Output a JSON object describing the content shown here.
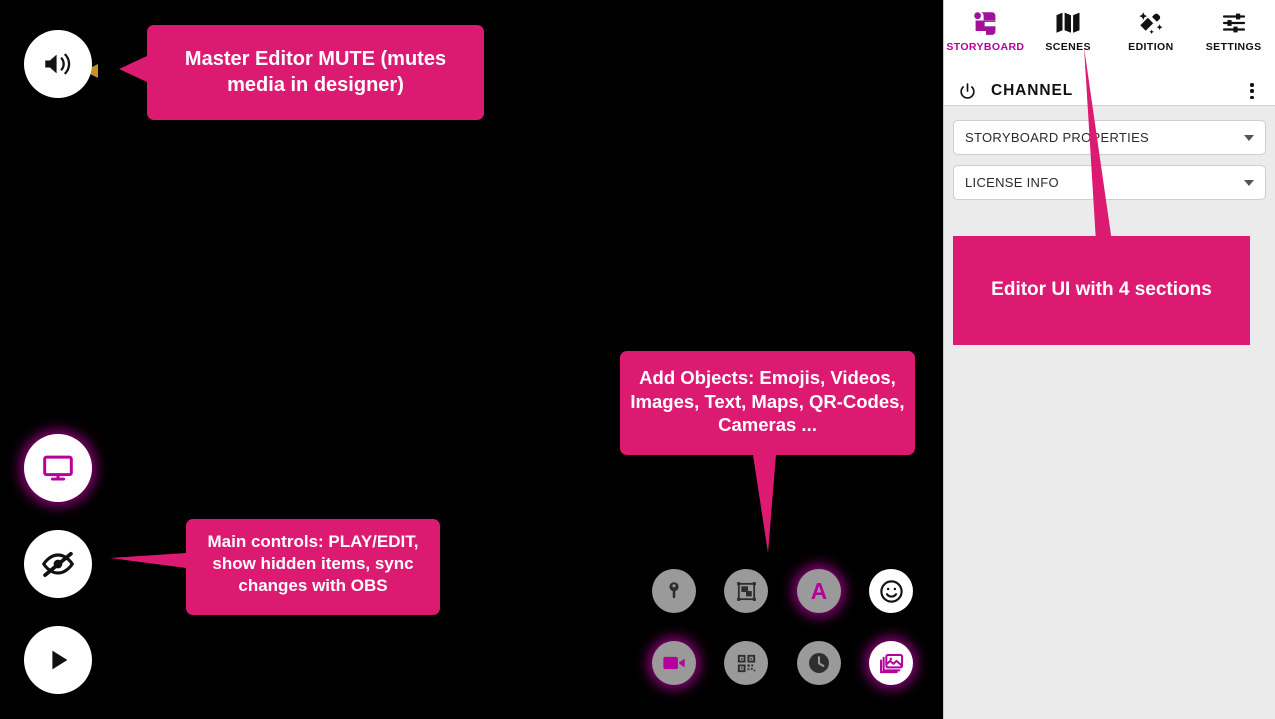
{
  "theme": {
    "callout_pink": "#dd1a71",
    "accent_magenta": "#b5009c",
    "canvas_bg": "#000000",
    "panel_bg": "#ebebeb"
  },
  "canvas": {
    "controls": [
      {
        "name": "master-mute",
        "icon": "speaker-icon",
        "label": "Master Editor MUTE"
      },
      {
        "name": "display-preview",
        "icon": "monitor-icon",
        "label": "Display"
      },
      {
        "name": "show-hidden",
        "icon": "eye-off-icon",
        "label": "Show hidden items"
      },
      {
        "name": "play",
        "icon": "play-icon",
        "label": "Play"
      }
    ],
    "objects": [
      {
        "name": "add-map",
        "icon": "map-pin-icon",
        "label": "Maps"
      },
      {
        "name": "add-shape",
        "icon": "shapes-icon",
        "label": "Shapes"
      },
      {
        "name": "add-text",
        "icon": "text-a-icon",
        "label": "Text"
      },
      {
        "name": "add-emoji",
        "icon": "emoji-icon",
        "label": "Emojis"
      },
      {
        "name": "add-video",
        "icon": "video-camera-icon",
        "label": "Videos"
      },
      {
        "name": "add-qr",
        "icon": "qr-code-icon",
        "label": "QR-Codes"
      },
      {
        "name": "add-clock",
        "icon": "clock-icon",
        "label": "Clock"
      },
      {
        "name": "add-image",
        "icon": "images-icon",
        "label": "Images"
      }
    ]
  },
  "callouts": {
    "mute": "Master Editor MUTE (mutes media in designer)",
    "main_controls": "Main controls: PLAY/EDIT, show hidden items, sync changes with OBS",
    "add_objects": "Add Objects: Emojis, Videos, Images, Text, Maps, QR-Codes, Cameras ...",
    "editor_ui": "Editor UI with 4 sections"
  },
  "panel": {
    "tabs": [
      {
        "label": "STORYBOARD",
        "icon": "scroll-icon",
        "active": true
      },
      {
        "label": "SCENES",
        "icon": "map-folded-icon",
        "active": false
      },
      {
        "label": "EDITION",
        "icon": "magic-pencil-icon",
        "active": false
      },
      {
        "label": "SETTINGS",
        "icon": "sliders-icon",
        "active": false
      }
    ],
    "channel": {
      "power_icon": "power-icon",
      "label": "CHANNEL",
      "menu_icon": "kebab-menu-icon"
    },
    "accordions": [
      {
        "label": "STORYBOARD PROPERTIES",
        "icon": "chevron-down-icon"
      },
      {
        "label": "LICENSE INFO",
        "icon": "chevron-down-icon"
      }
    ]
  }
}
